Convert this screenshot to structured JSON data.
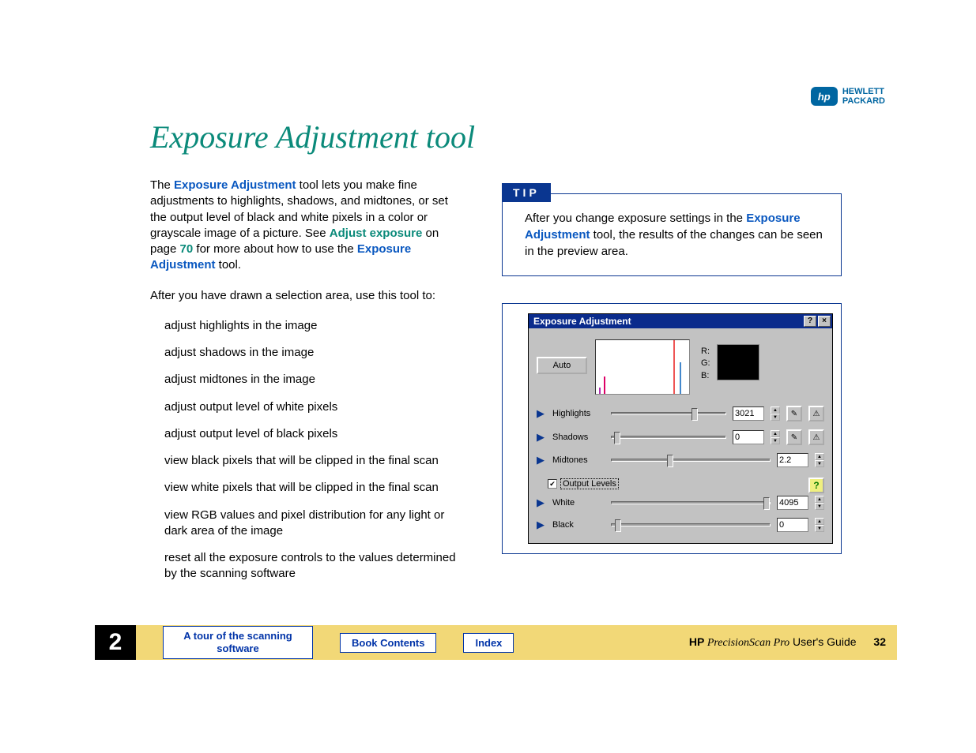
{
  "logo": {
    "badge": "hp",
    "line1": "HEWLETT",
    "line2": "PACKARD"
  },
  "title": "Exposure Adjustment tool",
  "para1": {
    "t1": "The ",
    "link1": "Exposure Adjustment",
    "t2": " tool lets you make fine adjustments to highlights, shadows, and midtones, or set the output level of black and white pixels in a color or grayscale image of a picture. See ",
    "link2": "Adjust exposure",
    "t3": " on page ",
    "pagelink": "70",
    "t4": " for more about how to use the ",
    "link3": "Exposure Adjustment",
    "t5": " tool."
  },
  "para2": "After you have drawn a selection area, use this tool to:",
  "actions": [
    "adjust highlights in the image",
    "adjust shadows in the image",
    "adjust midtones in the image",
    "adjust output level of white pixels",
    "adjust output level of black pixels",
    "view black pixels that will be clipped in the final scan",
    "view white pixels that will be clipped in the final scan",
    "view RGB values and pixel distribution for any light or dark area of the image",
    "reset all the exposure controls to the values determined by the scanning software"
  ],
  "tip": {
    "label": "TIP",
    "t1": "After you change exposure settings in the ",
    "link": "Exposure Adjustment",
    "t2": " tool, the results of the changes can be seen in the preview area."
  },
  "dialog": {
    "title": "Exposure Adjustment",
    "help": "?",
    "close": "×",
    "auto": "Auto",
    "rgb": {
      "r": "R:",
      "g": "G:",
      "b": "B:"
    },
    "rows": {
      "highlights": {
        "label": "Highlights",
        "value": "3021"
      },
      "shadows": {
        "label": "Shadows",
        "value": "0"
      },
      "midtones": {
        "label": "Midtones",
        "value": "2.2"
      },
      "white": {
        "label": "White",
        "value": "4095"
      },
      "black": {
        "label": "Black",
        "value": "0"
      }
    },
    "outputLevels": "Output Levels",
    "helpBadge": "?"
  },
  "footer": {
    "chapter": "2",
    "tour": "A tour of the scanning software",
    "contents": "Book Contents",
    "index": "Index",
    "hp": "HP",
    "guide": " PrecisionScan Pro",
    "guide2": " User's Guide",
    "page": "32"
  }
}
